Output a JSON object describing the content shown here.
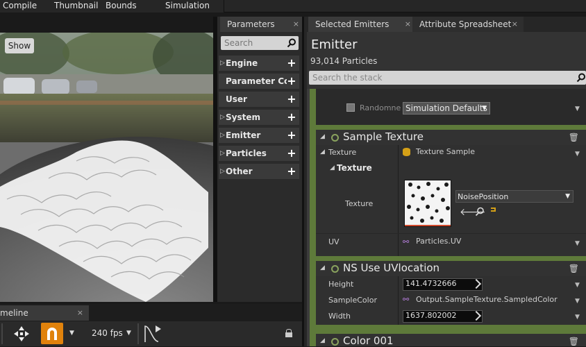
{
  "toolbar": {
    "items": [
      "Compile",
      "Thumbnail",
      "Bounds",
      "Simulation"
    ]
  },
  "viewport": {
    "show_button": "Show"
  },
  "parameters_panel": {
    "tab_label": "Parameters",
    "tab_close": "×",
    "search_placeholder": "Search",
    "categories": [
      {
        "label": "Engine",
        "arrow": "▷"
      },
      {
        "label": "Parameter Collections",
        "arrow": ""
      },
      {
        "label": "User",
        "arrow": ""
      },
      {
        "label": "System",
        "arrow": "▷"
      },
      {
        "label": "Emitter",
        "arrow": "▷"
      },
      {
        "label": "Particles",
        "arrow": "▷"
      },
      {
        "label": "Other",
        "arrow": "▷"
      }
    ]
  },
  "tabs": {
    "selected_emitters": "Selected Emitters",
    "attribute_spreadsheet": "Attribute Spreadsheet",
    "close": "×"
  },
  "emitter": {
    "title": "Emitter",
    "particle_count": "93,014 Particles",
    "search_placeholder": "Search the stack"
  },
  "stack": {
    "randomness_label": "Randomne",
    "randomness_value": "Simulation Defaults",
    "sample_texture": {
      "title": "Sample Texture",
      "texture_label": "Texture",
      "texture_value": "Texture Sample",
      "sub_header": "Texture",
      "texture_row_label": "Texture",
      "asset_name": "NoisePosition",
      "uv_label": "UV",
      "uv_value": "Particles.UV"
    },
    "ns_use_uvlocation": {
      "title": "NS Use UVlocation",
      "height_label": "Height",
      "height_value": "141.4732666",
      "samplecolor_label": "SampleColor",
      "samplecolor_value": "Output.SampleTexture.SampledColor",
      "width_label": "Width",
      "width_value": "1637.802002"
    },
    "color_module": {
      "title": "Color 001"
    }
  },
  "timeline": {
    "tab_label": "meline",
    "close": "×",
    "fps": "240 fps"
  },
  "colors": {
    "accent_green": "#5e7a3a",
    "magnet_orange": "#e0820c",
    "module_header": "#323232"
  }
}
